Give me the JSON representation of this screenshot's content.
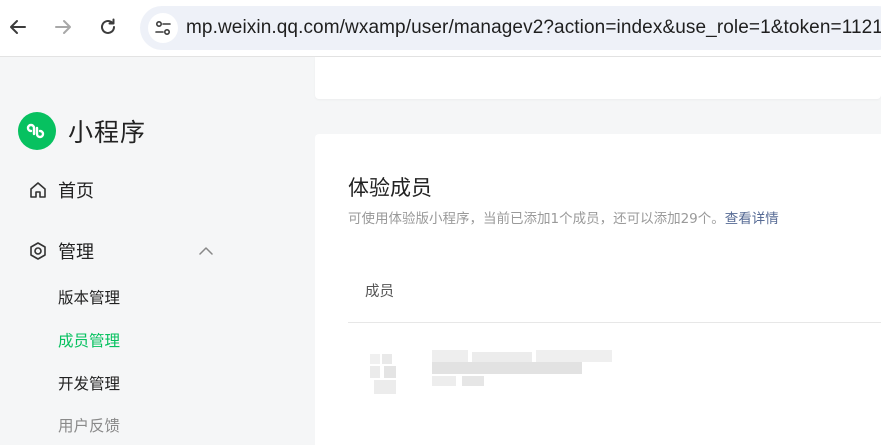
{
  "browser": {
    "url": "mp.weixin.qq.com/wxamp/user/managev2?action=index&use_role=1&token=1121"
  },
  "sidebar": {
    "logo_text": "小程序",
    "menu": [
      {
        "label": "首页",
        "icon": "home-icon"
      },
      {
        "label": "管理",
        "icon": "settings-hexagon-icon",
        "expanded": true
      }
    ],
    "sub_items": [
      {
        "label": "版本管理",
        "active": false
      },
      {
        "label": "成员管理",
        "active": true
      },
      {
        "label": "开发管理",
        "active": false
      },
      {
        "label": "用户反馈",
        "active": false
      }
    ]
  },
  "main": {
    "title": "体验成员",
    "description": "可使用体验版小程序，当前已添加1个成员，还可以添加29个。",
    "link_text": "查看详情",
    "table": {
      "columns": [
        "成员"
      ]
    }
  },
  "colors": {
    "accent": "#07c160",
    "link": "#576b95"
  }
}
